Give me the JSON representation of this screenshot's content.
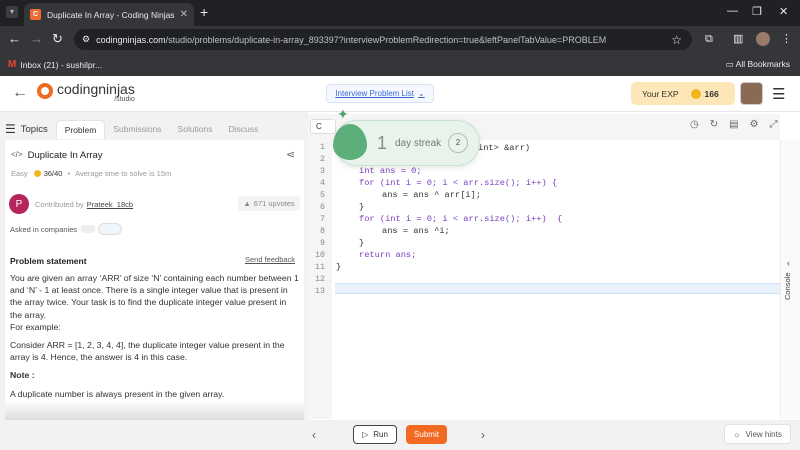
{
  "browser": {
    "tab_title": "Duplicate In Array - Coding Ninjas",
    "url_domain": "codingninjas.com",
    "url_path": "/studio/problems/duplicate-in-array_893397?interviewProblemRedirection=true&leftPanelTabValue=PROBLEM",
    "bookmark_gmail": "Inbox (21) - sushilpr...",
    "all_bookmarks": "All Bookmarks"
  },
  "header": {
    "logo_name": "codingninjas",
    "logo_sub": "/studio",
    "interview_list": "Interview Problem List",
    "exp_label": "Your EXP",
    "exp_value": "166"
  },
  "left_tabs": {
    "topics": "Topics",
    "items": [
      "Problem",
      "Submissions",
      "Solutions",
      "Discuss"
    ]
  },
  "problem": {
    "title": "Duplicate In Array",
    "difficulty": "Easy",
    "score": "36/40",
    "avg_time": "Average time to solve is 15m",
    "contributed_label": "Contributed by",
    "contributor": "Prateek_18cb",
    "contributor_initial": "P",
    "upvotes": "671 upvotes",
    "asked_label": "Asked in companies",
    "statement_heading": "Problem statement",
    "send_feedback": "Send feedback",
    "para1": "You are given an array ‘ARR’ of size ‘N’ containing each number between 1 and ‘N’ - 1 at least once. There is a single integer value that is present in the array twice. Your task is to find the duplicate integer value present in the array.",
    "para2": "For example:",
    "para3": "Consider ARR = [1, 2, 3, 4, 4], the duplicate integer value present in the array is 4. Hence, the answer is 4 in this case.",
    "note_label": "Note :",
    "note": "A duplicate number is always present in the given array."
  },
  "editor": {
    "lang": "C",
    "line_numbers": [
      "1",
      "2",
      "3",
      "4",
      "5",
      "6",
      "7",
      "8",
      "9",
      "10",
      "11",
      "12",
      "13"
    ],
    "line2_tail": "int> &arr)",
    "line3": "int ans = 0;",
    "line4": "for (int i = 0; i < arr.size(); i++) {",
    "line5": "ans = ans ^ arr[i];",
    "line6": "}",
    "line7": "for (int i = 0; i < arr.size(); i++)  {",
    "line8": "ans = ans ^i;",
    "line9": "}",
    "line10": "return ans;",
    "line11": "}"
  },
  "streak": {
    "count": "1",
    "label": "day streak",
    "badge": "2"
  },
  "side": {
    "console": "Console"
  },
  "footer": {
    "run": "Run",
    "submit": "Submit",
    "hints": "View hints"
  },
  "colors": {
    "accent": "#f26a21",
    "streak_green": "#5cae7a",
    "exp_bg": "#fde6b8"
  }
}
